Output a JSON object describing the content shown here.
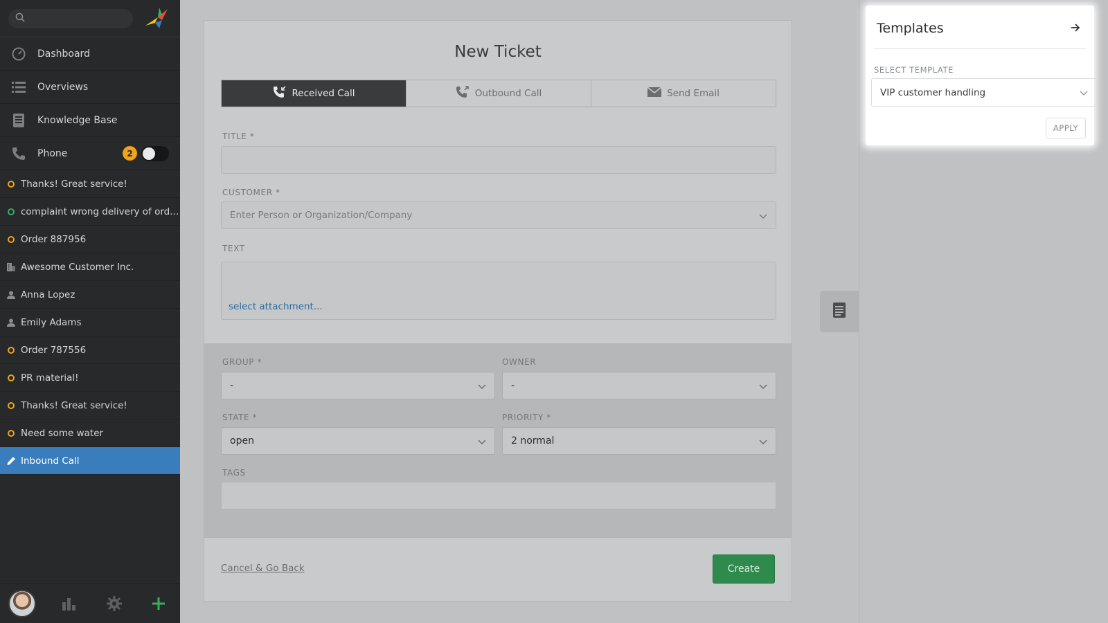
{
  "sidebar": {
    "search": {
      "placeholder": ""
    },
    "nav": [
      {
        "label": "Dashboard",
        "icon": "dashboard-icon"
      },
      {
        "label": "Overviews",
        "icon": "list-icon"
      },
      {
        "label": "Knowledge Base",
        "icon": "book-icon"
      },
      {
        "label": "Phone",
        "icon": "phone-icon",
        "badge": "2"
      }
    ],
    "tasks": [
      {
        "label": "Thanks! Great service!",
        "icon": "ticket-open-icon",
        "color": "#f1a31a"
      },
      {
        "label": "complaint wrong delivery of ord...",
        "icon": "ticket-open-icon",
        "color": "#38ad5f"
      },
      {
        "label": "Order 887956",
        "icon": "ticket-open-icon",
        "color": "#f1a31a"
      },
      {
        "label": "Awesome Customer Inc.",
        "icon": "organization-icon"
      },
      {
        "label": "Anna Lopez",
        "icon": "person-icon"
      },
      {
        "label": "Emily Adams",
        "icon": "person-icon"
      },
      {
        "label": "Order 787556",
        "icon": "ticket-open-icon",
        "color": "#f1a31a"
      },
      {
        "label": "PR material!",
        "icon": "ticket-open-icon",
        "color": "#f1a31a"
      },
      {
        "label": "Thanks! Great service!",
        "icon": "ticket-open-icon",
        "color": "#f1a31a"
      },
      {
        "label": "Need some water",
        "icon": "ticket-open-icon",
        "color": "#f1a31a"
      },
      {
        "label": "Inbound Call",
        "icon": "pencil-icon",
        "active": true
      }
    ]
  },
  "ticket": {
    "title": "New Ticket",
    "tabs": [
      {
        "label": "Received Call",
        "icon": "received-call-icon",
        "active": true
      },
      {
        "label": "Outbound Call",
        "icon": "outbound-call-icon"
      },
      {
        "label": "Send Email",
        "icon": "email-icon"
      }
    ],
    "fields": {
      "title_label": "TITLE *",
      "title_value": "",
      "customer_label": "CUSTOMER *",
      "customer_placeholder": "Enter Person or Organization/Company",
      "text_label": "TEXT",
      "attachment_link": "select attachment...",
      "group_label": "GROUP *",
      "group_value": "-",
      "owner_label": "OWNER",
      "owner_value": "-",
      "state_label": "STATE *",
      "state_value": "open",
      "priority_label": "PRIORITY *",
      "priority_value": "2 normal",
      "tags_label": "TAGS",
      "tags_value": ""
    },
    "cancel_label": "Cancel & Go Back",
    "create_label": "Create"
  },
  "templates": {
    "title": "Templates",
    "select_label": "SELECT TEMPLATE",
    "selected": "VIP customer handling",
    "apply_label": "APPLY"
  },
  "colors": {
    "accent_active": "#3a7dbd",
    "badge": "#f1a31a",
    "create_button": "#2f8a4d",
    "link": "#2d6ba0"
  }
}
